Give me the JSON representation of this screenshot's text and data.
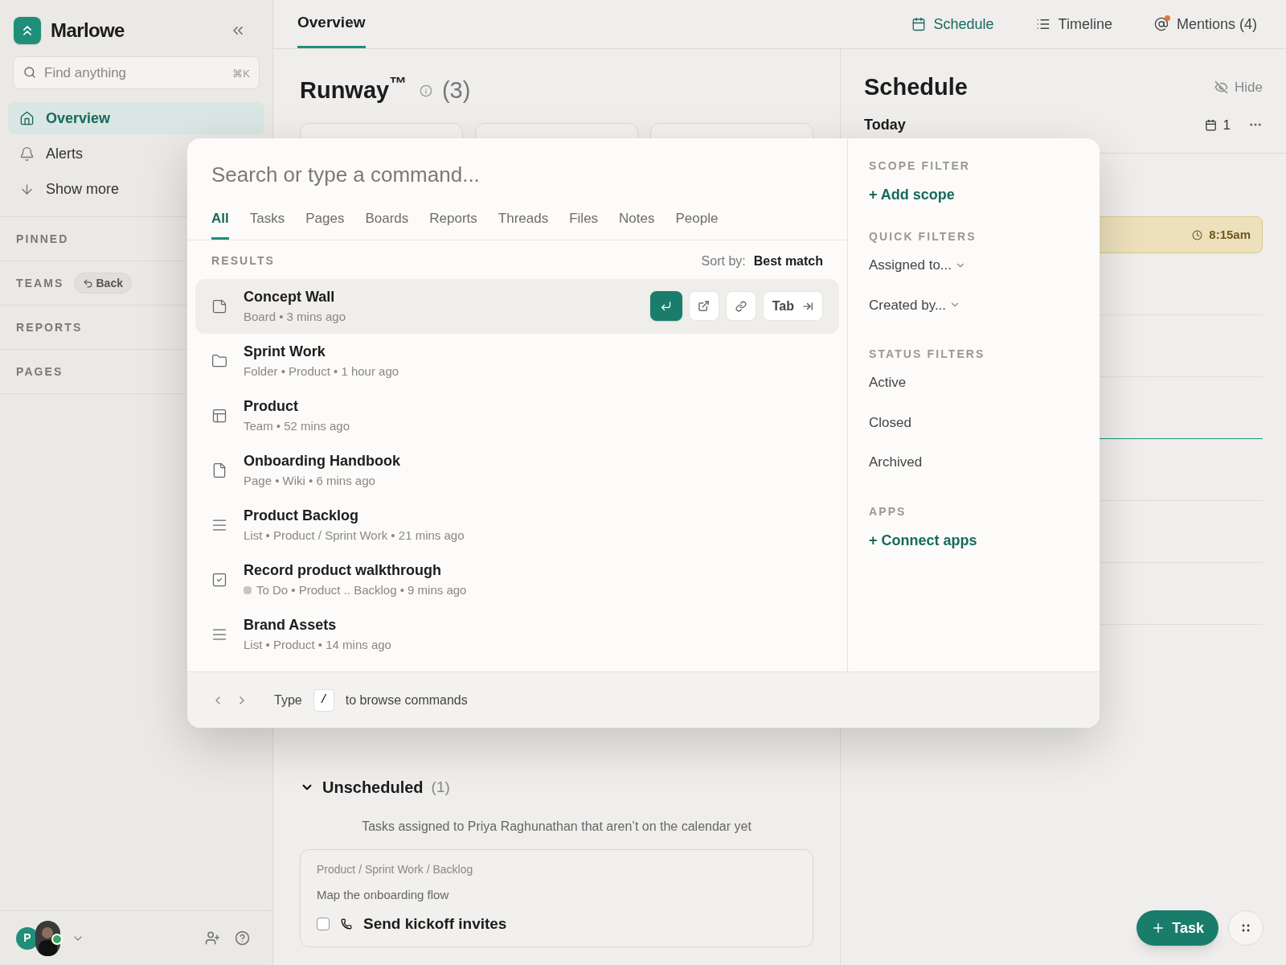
{
  "sidebar": {
    "brand": "Marlowe",
    "search": {
      "placeholder": "Find anything",
      "shortcut": "⌘K"
    },
    "nav": [
      {
        "kind": "home",
        "label": "Overview",
        "selected": true
      },
      {
        "kind": "bell",
        "label": "Alerts",
        "selected": false
      },
      {
        "kind": "more",
        "label": "Show more",
        "selected": false
      }
    ],
    "sections": [
      {
        "title": "PINNED"
      },
      {
        "title": "TEAMS",
        "action": "Back"
      },
      {
        "title": "REPORTS"
      },
      {
        "title": "PAGES"
      }
    ],
    "footer": {
      "avatar_initial": "P",
      "online": true
    }
  },
  "topbar": {
    "tabs": [
      {
        "label": "Overview",
        "selected": true
      }
    ],
    "links": [
      {
        "kind": "calendar",
        "label": "Schedule",
        "selected": true
      },
      {
        "kind": "list",
        "label": "Timeline",
        "selected": false
      },
      {
        "kind": "mention",
        "label": "Mentions (4)",
        "selected": false,
        "unread": true
      }
    ]
  },
  "main": {
    "title": "Runway$^{™}$",
    "count": "(3)",
    "unscheduled": {
      "title": "Unscheduled",
      "count": "(1)",
      "expanded": true,
      "description": "Tasks assigned to Priya Raghunathan that aren’t on the calendar yet",
      "card": {
        "breadcrumb": "Product / Sprint Work / Backlog",
        "subtitle": "Map the onboarding flow",
        "task": "Send kickoff invites",
        "checked": false
      }
    }
  },
  "schedule": {
    "title": "Schedule",
    "hide": "Hide",
    "day": "Today",
    "day_count": "1",
    "event_time": "8:15am"
  },
  "palette": {
    "placeholder": "Search or type a command...",
    "tabs": [
      {
        "label": "All",
        "selected": true
      },
      {
        "label": "Tasks",
        "selected": false
      },
      {
        "label": "Pages",
        "selected": false
      },
      {
        "label": "Boards",
        "selected": false
      },
      {
        "label": "Reports",
        "selected": false
      },
      {
        "label": "Threads",
        "selected": false
      },
      {
        "label": "Files",
        "selected": false
      },
      {
        "label": "Notes",
        "selected": false
      },
      {
        "label": "People",
        "selected": false
      }
    ],
    "results_label": "RESULTS",
    "sort_label": "Sort by:",
    "sort_value": "Best match",
    "tab_hint": "Tab",
    "results": [
      {
        "kind": "board",
        "title": "Concept Wall",
        "meta": "Board • 3 mins ago",
        "selected": true
      },
      {
        "kind": "folder",
        "title": "Sprint Work",
        "meta": "Folder • Product • 1 hour ago",
        "selected": false
      },
      {
        "kind": "team",
        "title": "Product",
        "meta": "Team • 52 mins ago",
        "selected": false
      },
      {
        "kind": "page",
        "title": "Onboarding Handbook",
        "meta": "Page • Wiki • 6 mins ago",
        "selected": false
      },
      {
        "kind": "list",
        "title": "Product Backlog",
        "meta": "List • Product / Sprint Work • 21 mins ago",
        "selected": false
      },
      {
        "kind": "task",
        "title": "Record product walkthrough",
        "meta": "To Do • Product .. Backlog • 9 mins ago",
        "color": "#c9c6c1",
        "selected": false
      },
      {
        "kind": "list",
        "title": "Brand Assets",
        "meta": "List • Product • 14 mins ago",
        "selected": false
      }
    ],
    "filters": [
      {
        "title": "SCOPE FILTER",
        "items": [
          {
            "kind": "link",
            "label": "+ Add scope"
          }
        ]
      },
      {
        "title": "QUICK FILTERS",
        "items": [
          {
            "kind": "dropdown",
            "label": "Assigned to..."
          },
          {
            "kind": "dropdown",
            "label": "Created by..."
          }
        ]
      },
      {
        "title": "STATUS FILTERS",
        "items": [
          {
            "kind": "option",
            "label": "Active"
          },
          {
            "kind": "option",
            "label": "Closed"
          },
          {
            "kind": "option",
            "label": "Archived"
          }
        ]
      },
      {
        "title": "APPS",
        "items": [
          {
            "kind": "link",
            "label": "+ Connect apps"
          }
        ]
      }
    ],
    "footer": {
      "before": "Type",
      "key": "/",
      "after": "to browse commands"
    }
  },
  "fab": {
    "label": "Task"
  }
}
